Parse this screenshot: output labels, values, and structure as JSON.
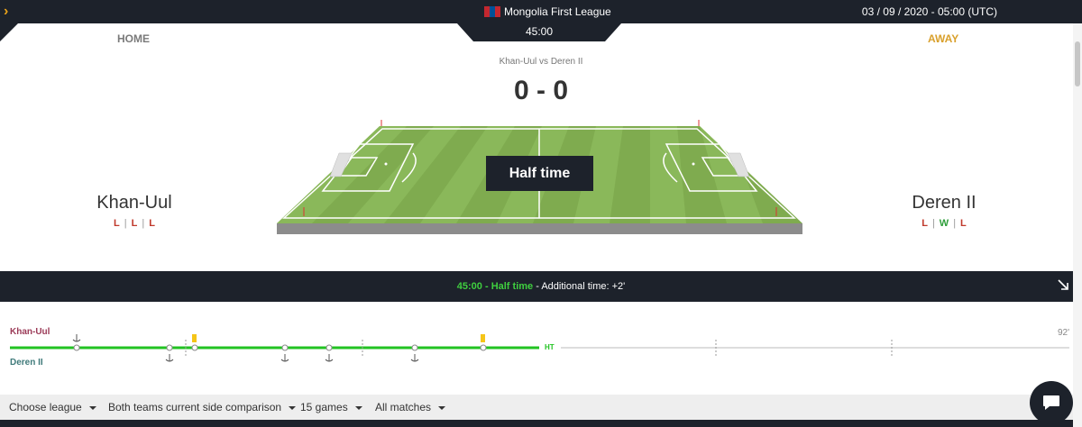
{
  "header": {
    "league": "Mongolia First League",
    "clock": "45:00",
    "datetime": "03 / 09 / 2020 - 05:00 (UTC)",
    "flag_colors": [
      "#c4272f",
      "#015197",
      "#c4272f"
    ]
  },
  "labels": {
    "home": "HOME",
    "away": "AWAY"
  },
  "match": {
    "title": "Khan-Uul vs Deren II",
    "score": "0 - 0",
    "status": "Half time"
  },
  "home": {
    "name": "Khan-Uul",
    "form": [
      "L",
      "L",
      "L"
    ]
  },
  "away": {
    "name": "Deren II",
    "form": [
      "L",
      "W",
      "L"
    ]
  },
  "status_bar": {
    "time": "45:00",
    "dash1": " - ",
    "phase": "Half time",
    "extra": " - Additional time: +2'"
  },
  "timeline": {
    "home_label": "Khan-Uul",
    "away_label": "Deren II",
    "ht_label": "HT",
    "end_label": "92'"
  },
  "filters": {
    "league": "Choose league",
    "comparison": "Both teams current side comparison",
    "games": "15 games",
    "matches": "All matches"
  },
  "colors": {
    "dark": "#1d222b",
    "accent_orange": "#e8a21a",
    "away_gold": "#d9a02c",
    "green": "#3fcf3f",
    "loss_red": "#c0392b",
    "win_green": "#2e9e3a"
  },
  "icons": {
    "toggle": "chevron-right-icon",
    "expand": "arrow-down-right-icon",
    "chat": "chat-bubble-icon"
  }
}
